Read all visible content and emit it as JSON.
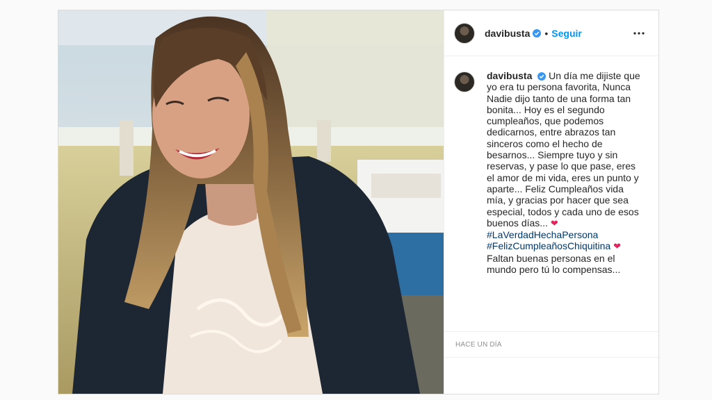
{
  "post": {
    "username": "davibusta",
    "separator": "•",
    "follow_label": "Seguir",
    "verified_icon": "verified-badge-icon",
    "more_icon": "more-options-icon"
  },
  "caption": {
    "username": "davibusta",
    "text_1": "Un día me dijiste que yo era tu persona favorita, Nunca Nadie dijo tanto de una forma tan bonita... Hoy es el segundo cumpleaños, que podemos dedicarnos, entre abrazos tan sinceros como el hecho de besarnos... Siempre tuyo y sin reservas, y pase lo que pase, eres el amor de mi vida, eres un punto y aparte... Feliz Cumpleaños vida mía, y gracias por hacer que sea especial, todos y cada uno de esos buenos días... ",
    "heart_1": "❤",
    "hashtag_1": "#LaVerdadHechaPersona",
    "hashtag_2": "#FelizCumpleañosChiquitina",
    "heart_2": "❤",
    "text_2": "Faltan buenas personas en el mundo pero tú lo compensas..."
  },
  "timestamp": "HACE UN DÍA",
  "colors": {
    "link": "#0095f6",
    "hashtag": "#00376b",
    "heart": "#e0245e",
    "muted": "#8e8e8e"
  }
}
